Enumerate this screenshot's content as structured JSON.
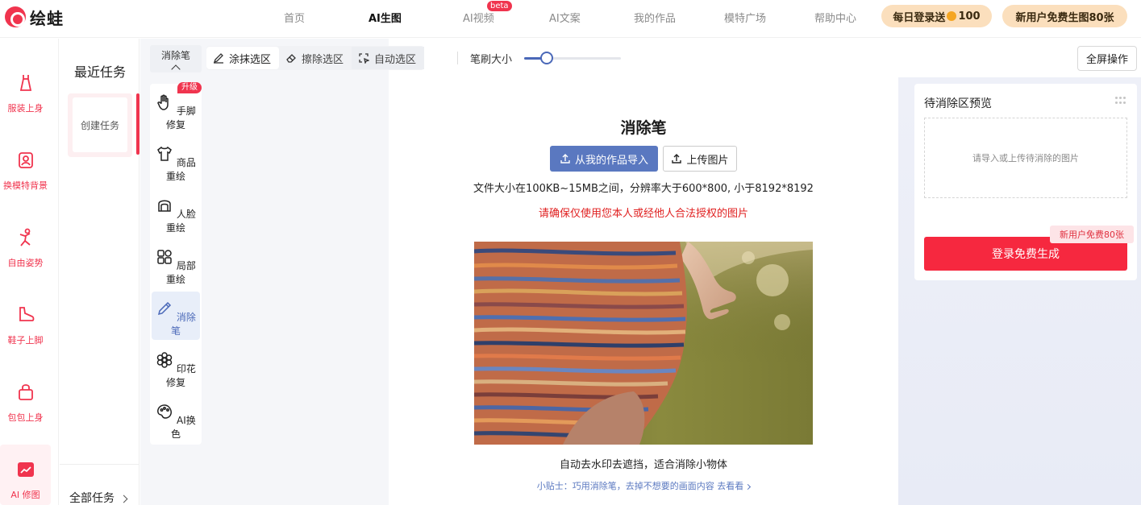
{
  "brand": {
    "name": "绘蛙",
    "color": "#f0344e"
  },
  "nav": {
    "items": [
      "首页",
      "AI生图",
      "AI视频",
      "AI文案",
      "我的作品",
      "模特广场",
      "帮助中心"
    ],
    "active_index": 1,
    "beta_badge": "beta",
    "daily_login_prefix": "每日登录送",
    "daily_login_value": "100",
    "new_user_promo": "新用户免费生图80张"
  },
  "rail": {
    "items": [
      {
        "label": "服装上身",
        "icon": "dress-icon"
      },
      {
        "label": "换模特背景",
        "icon": "model-icon"
      },
      {
        "label": "自由姿势",
        "icon": "pose-icon"
      },
      {
        "label": "鞋子上脚",
        "icon": "shoe-icon"
      },
      {
        "label": "包包上身",
        "icon": "bag-icon"
      },
      {
        "label": "AI 修图",
        "icon": "image-edit-icon"
      }
    ],
    "active_index": 5
  },
  "tasks": {
    "title": "最近任务",
    "create_label": "创建任务",
    "all_label": "全部任务"
  },
  "tools": {
    "header": "消除笔",
    "upgrade_badge": "升级",
    "items": [
      {
        "label": "手脚修复",
        "icon": "hand-icon"
      },
      {
        "label": "商品重绘",
        "icon": "tshirt-icon"
      },
      {
        "label": "人脸重绘",
        "icon": "face-icon"
      },
      {
        "label": "局部重绘",
        "icon": "partial-icon"
      },
      {
        "label": "消除笔",
        "icon": "pen-icon"
      },
      {
        "label": "印花修复",
        "icon": "flower-icon"
      },
      {
        "label": "AI换色",
        "icon": "palette-icon"
      }
    ],
    "active_index": 4
  },
  "toolbar": {
    "paint_select": "涂抹选区",
    "erase_select": "擦除选区",
    "auto_select": "自动选区",
    "brush_size_label": "笔刷大小",
    "brush_size_level": 0.23,
    "fullscreen": "全屏操作"
  },
  "canvas": {
    "title": "消除笔",
    "import_button": "从我的作品导入",
    "upload_button": "上传图片",
    "file_info": "文件大小在100KB~15MB之间，分辨率大于600*800, 小于8192*8192",
    "warning": "请确保仅使用您本人或经他人合法授权的图片",
    "caption": "自动去水印去遮挡，适合消除小物体",
    "tip": "小贴士：巧用消除笔，去掉不想要的画面内容 去看看"
  },
  "right": {
    "title": "待消除区预览",
    "drop_hint": "请导入或上传待消除的图片",
    "promo_tag": "新用户免费80张",
    "generate_button": "登录免费生成"
  }
}
